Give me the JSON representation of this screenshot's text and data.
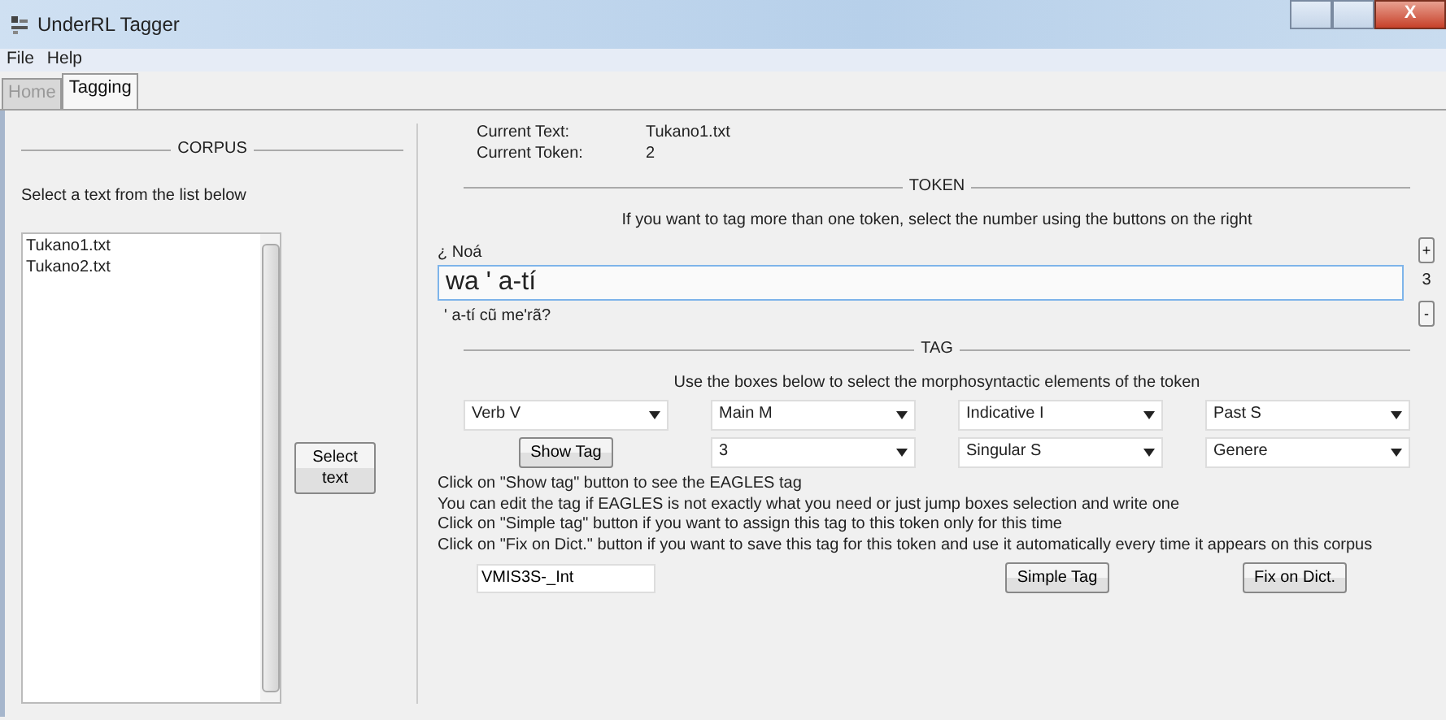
{
  "window": {
    "title": "UnderRL Tagger",
    "close_glyph": "X"
  },
  "menu": [
    "File",
    "Help"
  ],
  "tabs": [
    {
      "label": "Home",
      "selected": false
    },
    {
      "label": "Tagging",
      "selected": true
    }
  ],
  "corpus": {
    "heading": "CORPUS",
    "instruction": "Select a text from the list below",
    "files": [
      {
        "label": "Tukano1.txt",
        "selected": false
      },
      {
        "label": "Tukano2.txt",
        "selected": false
      }
    ],
    "select_button": "Select text"
  },
  "status": [
    {
      "label": "Current Text:",
      "value": "Tukano1.txt"
    },
    {
      "label": "Current Token:",
      "value": "2"
    }
  ],
  "token": {
    "heading": "TOKEN",
    "instruction": "If you want to tag more than one token, select the number using the buttons on the right",
    "previous": "¿ Noá",
    "current": "wa ' a-tí",
    "next": "' a-tí cũ me'rã?",
    "plus": "+",
    "count": "3",
    "minus": "-"
  },
  "tag": {
    "heading": "TAG",
    "instruction": "Use the boxes below to select the morphosyntactic elements of the token",
    "row_1": [
      "Verb V",
      "Main M",
      "Indicative I",
      "Past S"
    ],
    "show_tag_button": "Show Tag",
    "row_2": [
      "3",
      "Singular S",
      "Genere"
    ],
    "help_lines": [
      "Click on \"Show tag\" button to see the EAGLES tag",
      "You can edit the tag if EAGLES is not exactly what you need or just jump boxes selection and write one",
      "Click on \"Simple tag\" button if you want to assign this tag to this token only for this time",
      "Click on \"Fix on Dict.\" button if you want to save this tag for this token and use it automatically every time it appears on this corpus"
    ],
    "tag_value": "VMIS3S-_Int",
    "simple_button": "Simple Tag",
    "fix_button": "Fix on Dict."
  }
}
